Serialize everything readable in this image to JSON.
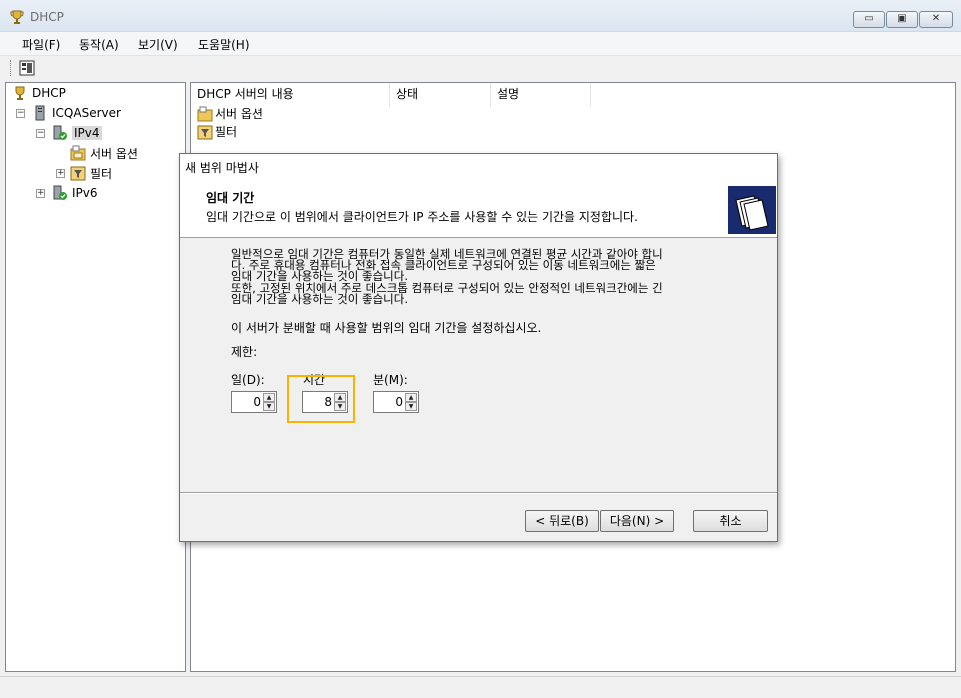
{
  "window": {
    "title": "DHCP",
    "minimize": "▭",
    "maximize": "▣",
    "close": "✕"
  },
  "menu": [
    "파일(F)",
    "동작(A)",
    "보기(V)",
    "도움말(H)"
  ],
  "toolbar": {
    "icon": "console-tree-icon"
  },
  "tree": {
    "root": "DHCP",
    "server": "ICQAServer",
    "ipv4": "IPv4",
    "server_options": "서버 옵션",
    "filters": "필터",
    "ipv6": "IPv6"
  },
  "list": {
    "columns": [
      "DHCP 서버의 내용",
      "상태",
      "설명"
    ],
    "items": [
      "서버 옵션",
      "필터"
    ]
  },
  "dialog": {
    "title": "새 범위 마법사",
    "header_title": "임대 기간",
    "header_subtitle": "임대 기간으로 이 범위에서 클라이언트가 IP 주소를 사용할 수 있는 기간을 지정합니다.",
    "para1_line1": "일반적으로 임대 기간은 컴퓨터가 동일한 실제 네트워크에 연결된 평균 시간과 같아야 합니",
    "para1_line2": "다. 주로 휴대용 컴퓨터나 전화 접속 클라이언트로 구성되어 있는 이동 네트워크에는 짧은",
    "para1_line3": "임대 기간을 사용하는 것이 좋습니다.",
    "para2_line1": "또한, 고정된 위치에서 주로 데스크톱 컴퓨터로 구성되어 있는 안정적인 네트워크간에는 긴",
    "para2_line2": "임대 기간을 사용하는 것이 좋습니다.",
    "instruction": "이 서버가 분배할 때 사용할 범위의 임대 기간을 설정하십시오.",
    "limit_label": "제한:",
    "days_label": "일(D):",
    "hours_label": "시간",
    "minutes_label": "분(M):",
    "days_value": "0",
    "hours_value": "8",
    "minutes_value": "0",
    "back_button": "< 뒤로(B)",
    "next_button": "다음(N) >",
    "cancel_button": "취소"
  },
  "colors": {
    "highlight": "#f5b400",
    "header_icon_bg": "#1a2a6e"
  }
}
